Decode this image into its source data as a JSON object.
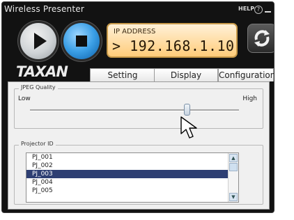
{
  "window": {
    "title": "Wireless Presenter",
    "help_label": "HELP",
    "help_glyph": "?",
    "close_glyph": "×"
  },
  "controls": {
    "play_icon": "play-icon",
    "stop_icon": "stop-icon",
    "ip_label": "IP ADDRESS",
    "ip_value": "> 192.168.1.10",
    "refresh_icon": "refresh-icon"
  },
  "brand": {
    "logo": "TAXAN"
  },
  "tabs": [
    {
      "label": "Setting",
      "active": false
    },
    {
      "label": "Display",
      "active": false
    },
    {
      "label": "Configuration",
      "active": false
    }
  ],
  "jpeg_quality": {
    "title": "JPEG Quality",
    "low_label": "Low",
    "high_label": "High",
    "value_fraction": 0.75
  },
  "projector": {
    "title": "Projector ID",
    "items": [
      "PJ_001",
      "PJ_002",
      "PJ_003",
      "PJ_004",
      "PJ_005"
    ],
    "selected_index": 2
  },
  "colors": {
    "accent_blue": "#3b9fe6",
    "ip_panel": "#ffcc7a",
    "selection": "#2e3f73"
  }
}
